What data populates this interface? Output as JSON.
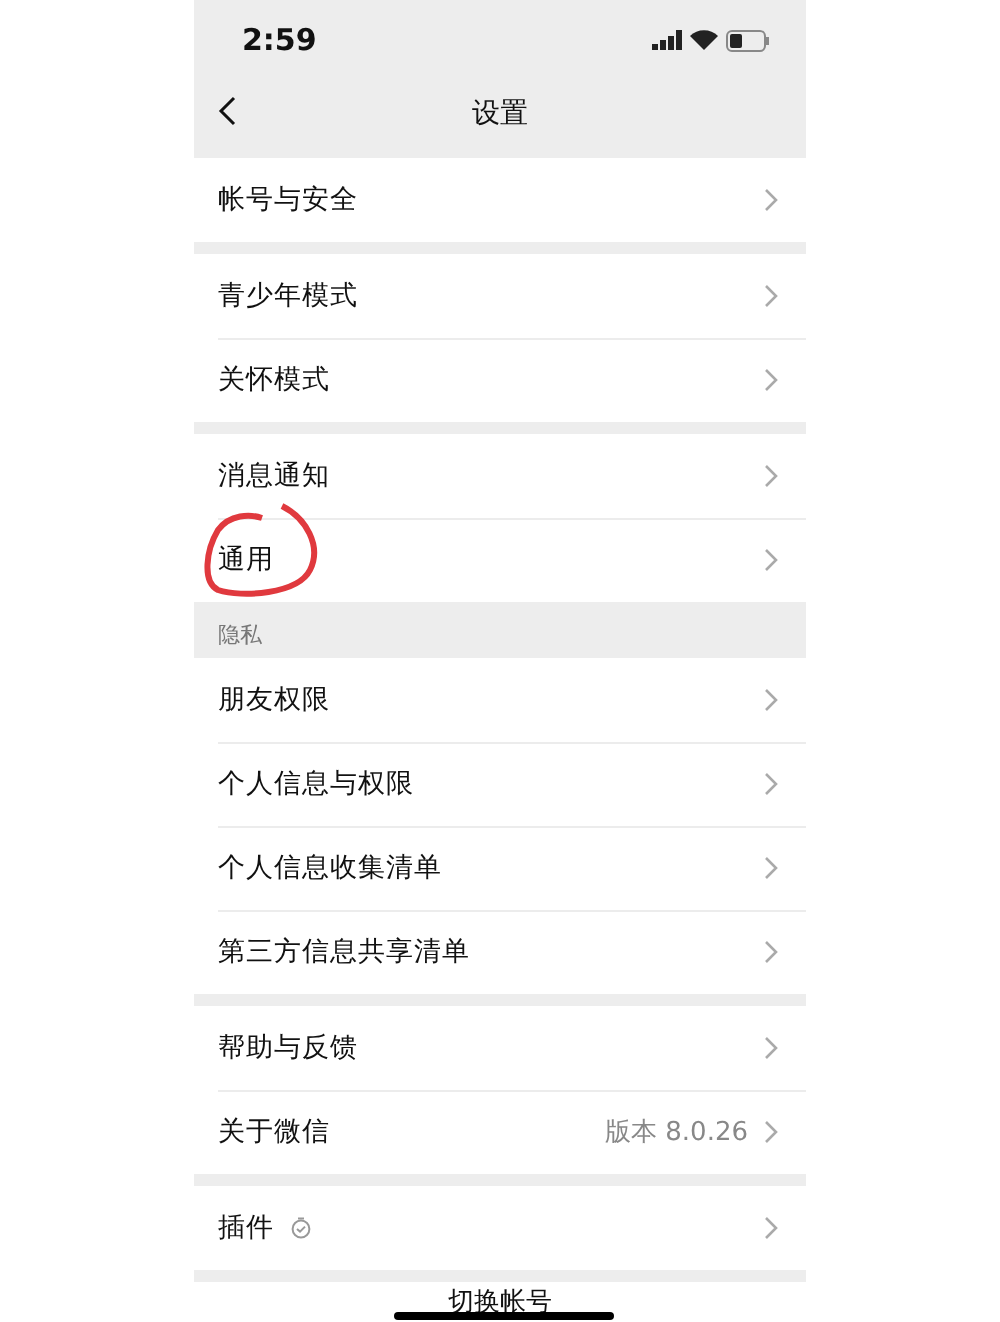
{
  "status_bar": {
    "time": "2:59"
  },
  "nav": {
    "title": "设置"
  },
  "groups": [
    {
      "items": [
        {
          "label": "帐号与安全",
          "kind": "plain",
          "circled": false
        }
      ]
    },
    {
      "items": [
        {
          "label": "青少年模式",
          "kind": "plain",
          "circled": false
        },
        {
          "label": "关怀模式",
          "kind": "plain",
          "circled": false
        }
      ]
    },
    {
      "items": [
        {
          "label": "消息通知",
          "kind": "plain",
          "circled": false
        },
        {
          "label": "通用",
          "kind": "plain",
          "circled": true
        }
      ]
    },
    {
      "header": "隐私",
      "items": [
        {
          "label": "朋友权限",
          "kind": "plain",
          "circled": false
        },
        {
          "label": "个人信息与权限",
          "kind": "plain",
          "circled": false
        },
        {
          "label": "个人信息收集清单",
          "kind": "plain",
          "circled": false
        },
        {
          "label": "第三方信息共享清单",
          "kind": "plain",
          "circled": false
        }
      ]
    },
    {
      "items": [
        {
          "label": "帮助与反馈",
          "kind": "plain",
          "circled": false
        },
        {
          "label": "关于微信",
          "kind": "value",
          "value": "版本 8.0.26",
          "circled": false
        }
      ]
    },
    {
      "items": [
        {
          "label": "插件",
          "kind": "icon",
          "circled": false
        }
      ]
    }
  ],
  "footer_button": "切换帐号"
}
